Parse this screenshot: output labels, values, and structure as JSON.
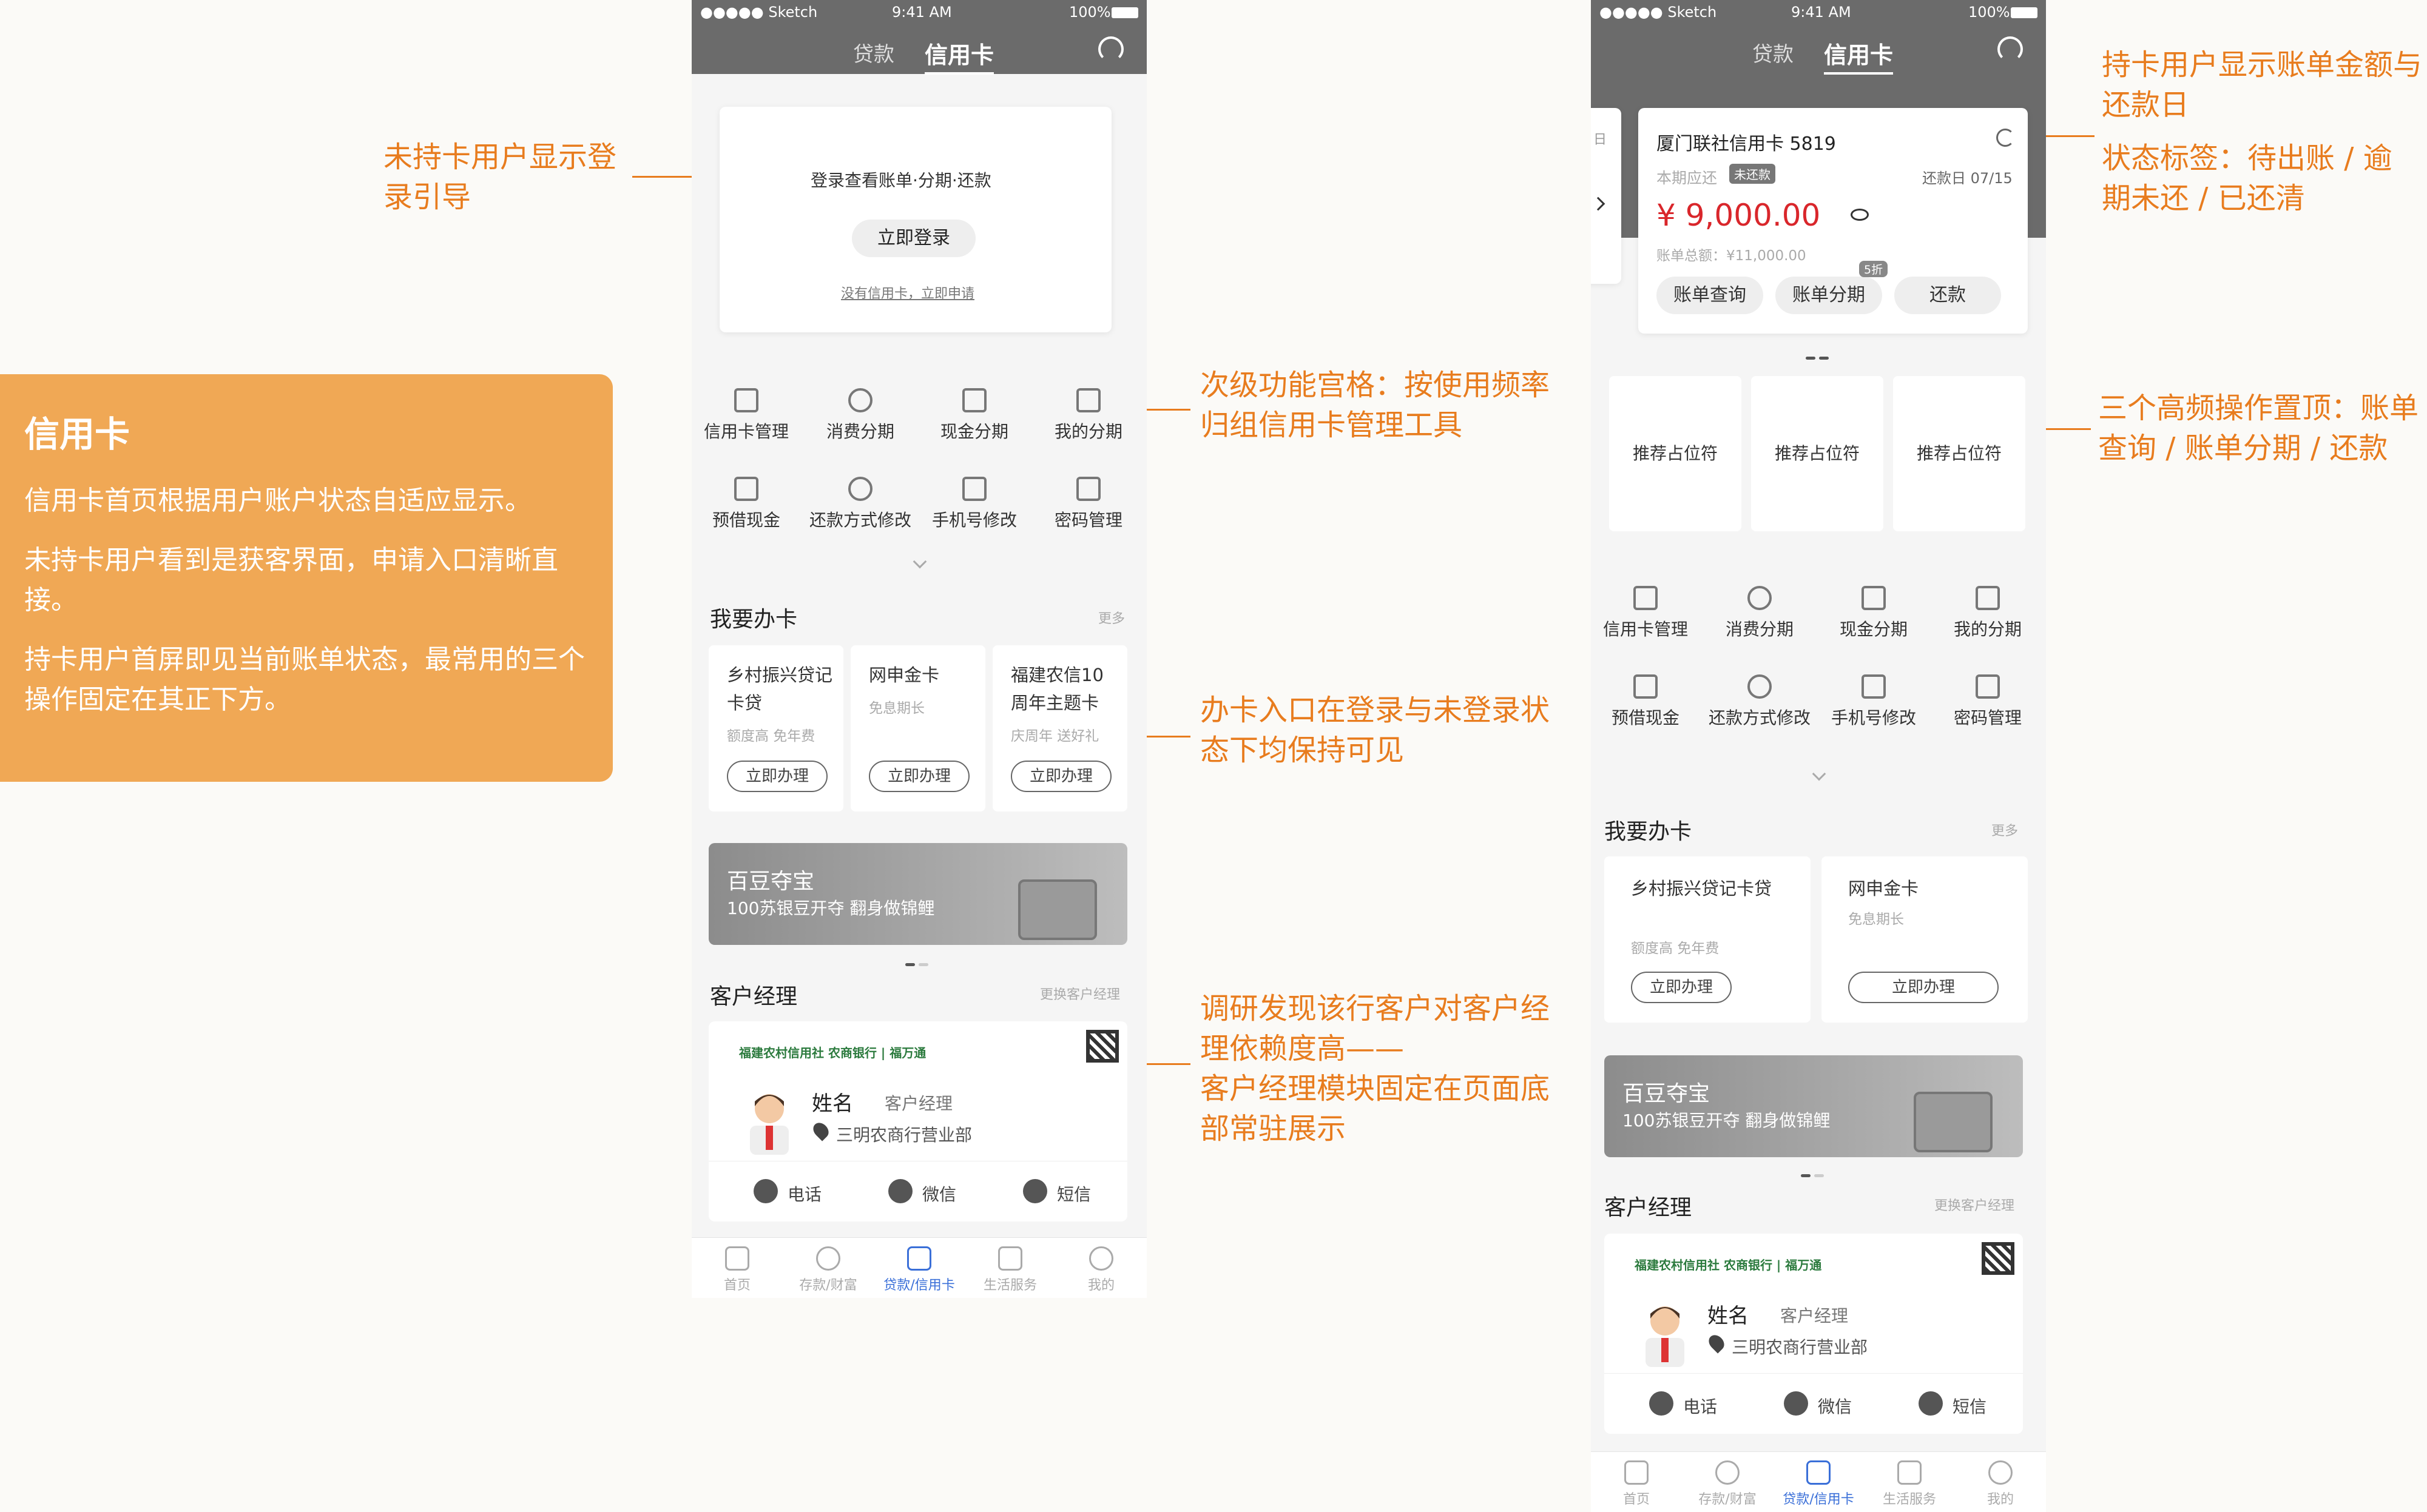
{
  "info": {
    "title": "信用卡",
    "p1": "信用卡首页根据用户账户状态自适应显示。",
    "p2": "未持卡用户看到是获客界面，申请入口清晰直接。",
    "p3": "持卡用户首屏即见当前账单状态，最常用的三个操作固定在其正下方。"
  },
  "annotations": {
    "a1": [
      "未持卡用户显示登",
      "录引导"
    ],
    "a2": [
      "次级功能宫格：按使用频率",
      "归组信用卡管理工具"
    ],
    "a3": [
      "办卡入口在登录与未登录状",
      "态下均保持可见"
    ],
    "a4": [
      "调研发现该行客户对客户经",
      "理依赖度高——",
      "客户经理模块固定在页面底",
      "部常驻展示"
    ],
    "a5": [
      "持卡用户显示账单金额与",
      "还款日"
    ],
    "a6": [
      "状态标签：待出账 / 逾",
      "期未还 / 已还清"
    ],
    "a7": [
      "三个高频操作置顶：账单",
      "查询 / 账单分期 / 还款"
    ]
  },
  "status": {
    "carrier": "●●●●● Sketch",
    "time": "9:41 AM",
    "battery": "100%"
  },
  "nav": {
    "tab1": "贷款",
    "tab2": "信用卡"
  },
  "login": {
    "prompt": "登录查看账单·分期·还款",
    "button": "立即登录",
    "link": "没有信用卡，立即申请"
  },
  "grid": [
    {
      "label": "信用卡管理",
      "icon": "card-manage-icon"
    },
    {
      "label": "消费分期",
      "icon": "timer-icon"
    },
    {
      "label": "现金分期",
      "icon": "chart-icon"
    },
    {
      "label": "我的分期",
      "icon": "bookmark-icon"
    },
    {
      "label": "预借现金",
      "icon": "card-manage-icon"
    },
    {
      "label": "还款方式修改",
      "icon": "timer-icon"
    },
    {
      "label": "手机号修改",
      "icon": "chart-icon"
    },
    {
      "label": "密码管理",
      "icon": "bookmark-icon"
    }
  ],
  "apply_section": {
    "title": "我要办卡",
    "more": "更多"
  },
  "apply_cards_left": [
    {
      "name": "乡村振兴贷记卡贷",
      "sub": "额度高 免年费",
      "btn": "立即办理"
    },
    {
      "name": "网申金卡",
      "sub": "免息期长",
      "btn": "立即办理"
    },
    {
      "name": "福建农信10周年主题卡",
      "sub": "庆周年 送好礼",
      "btn": "立即办理"
    }
  ],
  "apply_cards_right": [
    {
      "name": "乡村振兴贷记卡贷",
      "sub": "额度高 免年费",
      "btn": "立即办理"
    },
    {
      "name": "网申金卡",
      "sub": "免息期长",
      "btn": "立即办理"
    }
  ],
  "banner": {
    "title": "百豆夺宝",
    "sub": "100苏银豆开夺 翻身做锦鲤"
  },
  "manager": {
    "title": "客户经理",
    "change": "更换客户经理",
    "logo": "福建农村信用社 农商银行 | 福万通",
    "name": "姓名",
    "role": "客户经理",
    "branch": "三明农商行营业部",
    "call": "电话",
    "wechat": "微信",
    "sms": "短信"
  },
  "tabs": [
    "首页",
    "存款/财富",
    "贷款/信用卡",
    "生活服务",
    "我的"
  ],
  "bill": {
    "card": "厦门联社信用卡 5819",
    "due_label": "本期应还",
    "status": "未还款",
    "due_date": "还款日 07/15",
    "amount": "¥ 9,000.00",
    "total": "账单总额：¥11,000.00",
    "side_label": "日",
    "btn1": "账单查询",
    "btn2": "账单分期",
    "btn2_badge": "5折",
    "btn3": "还款"
  },
  "recommend": [
    "推荐占位符",
    "推荐占位符",
    "推荐占位符"
  ],
  "colors": {
    "accent": "#e87c1e",
    "info_bg": "#f0a855",
    "nav_bg": "#6b6b6b",
    "tab_active": "#3a6fd8",
    "amount": "#d9262b"
  }
}
